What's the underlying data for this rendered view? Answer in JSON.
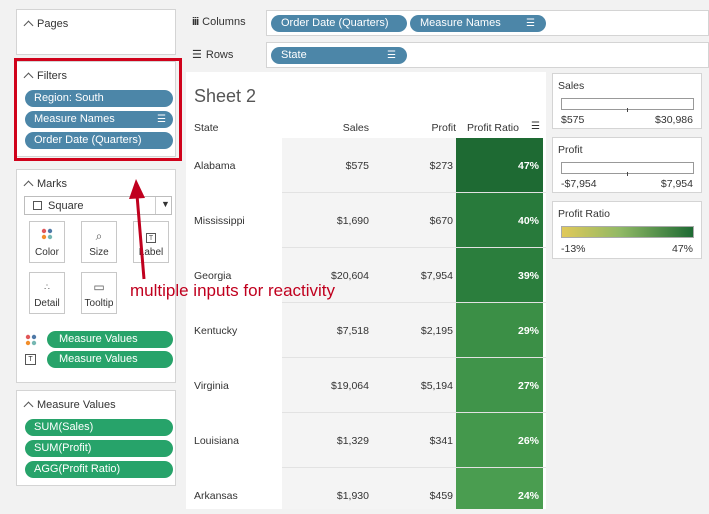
{
  "pages": {
    "title": "Pages"
  },
  "filters": {
    "title": "Filters",
    "pills": [
      {
        "label": "Region: South",
        "sort": ""
      },
      {
        "label": "Measure Names",
        "sort": "☰"
      },
      {
        "label": "Order Date (Quarters)",
        "sort": ""
      }
    ]
  },
  "marks": {
    "title": "Marks",
    "type": "Square",
    "buttons": [
      "Color",
      "Size",
      "Label",
      "Detail",
      "Tooltip"
    ],
    "fields": [
      "Measure Values",
      "Measure Values"
    ]
  },
  "measure_values": {
    "title": "Measure Values",
    "pills": [
      "SUM(Sales)",
      "SUM(Profit)",
      "AGG(Profit Ratio)"
    ]
  },
  "shelves": {
    "columns_label": "Columns",
    "columns_pills": [
      "Order Date (Quarters)",
      "Measure Names"
    ],
    "rows_label": "Rows",
    "rows_pills": [
      "State"
    ]
  },
  "sheet": {
    "title": "Sheet 2",
    "headers": {
      "state": "State",
      "sales": "Sales",
      "profit": "Profit",
      "ratio": "Profit Ratio"
    },
    "rows": [
      {
        "state": "Alabama",
        "sales": "$575",
        "profit": "$273",
        "ratio": "47%",
        "color": "#1e6a33"
      },
      {
        "state": "Mississippi",
        "sales": "$1,690",
        "profit": "$670",
        "ratio": "40%",
        "color": "#287a3b"
      },
      {
        "state": "Georgia",
        "sales": "$20,604",
        "profit": "$7,954",
        "ratio": "39%",
        "color": "#2b7e3d"
      },
      {
        "state": "Kentucky",
        "sales": "$7,518",
        "profit": "$2,195",
        "ratio": "29%",
        "color": "#3b8f46"
      },
      {
        "state": "Virginia",
        "sales": "$19,064",
        "profit": "$5,194",
        "ratio": "27%",
        "color": "#40944a"
      },
      {
        "state": "Louisiana",
        "sales": "$1,329",
        "profit": "$341",
        "ratio": "26%",
        "color": "#44984c"
      },
      {
        "state": "Arkansas",
        "sales": "$1,930",
        "profit": "$459",
        "ratio": "24%",
        "color": "#4a9d50"
      }
    ]
  },
  "legends": {
    "sales": {
      "title": "Sales",
      "min": "$575",
      "max": "$30,986"
    },
    "profit": {
      "title": "Profit",
      "min": "-$7,954",
      "max": "$7,954"
    },
    "ratio": {
      "title": "Profit Ratio",
      "min": "-13%",
      "max": "47%",
      "color_low": "#e1c95a",
      "color_high": "#1e6a33"
    }
  },
  "annotation": "multiple inputs for reactivity",
  "colors": {
    "pill_blue": "#4c86a8",
    "pill_green": "#27a36a",
    "highlight_red": "#d0021b"
  }
}
